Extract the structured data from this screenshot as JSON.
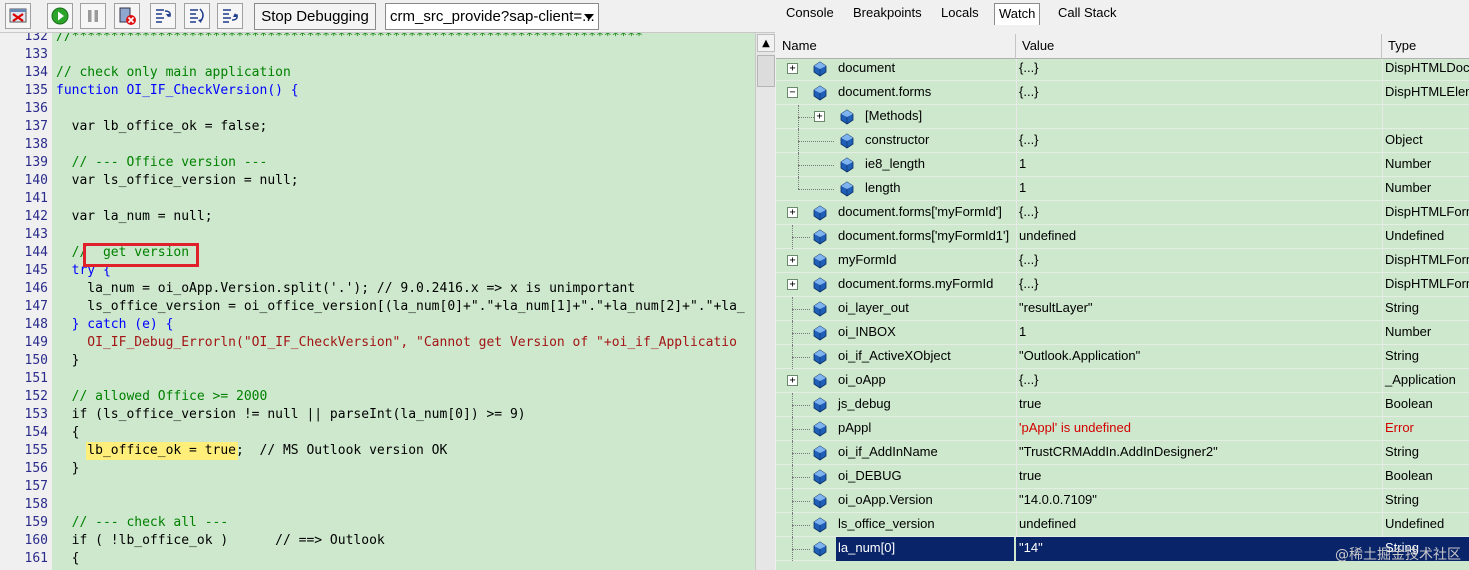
{
  "toolbar": {
    "stop_label": "Stop Debugging",
    "source_select": "crm_src_provide?sap-client=..."
  },
  "tabs": [
    "Console",
    "Breakpoints",
    "Locals",
    "Watch",
    "Call Stack"
  ],
  "active_tab": "Watch",
  "watch": {
    "columns": [
      "Name",
      "Value",
      "Type"
    ],
    "rows": [
      {
        "name": "document",
        "value": "{...}",
        "type": "DispHTMLDocu",
        "expander": "plus",
        "level": 0
      },
      {
        "name": "document.forms",
        "value": "{...}",
        "type": "DispHTMLElem",
        "expander": "minus",
        "level": 0
      },
      {
        "name": "[Methods]",
        "value": "",
        "type": "",
        "expander": "plus",
        "level": 1
      },
      {
        "name": "constructor",
        "value": "{...}",
        "type": "Object",
        "expander": "",
        "level": 1
      },
      {
        "name": "ie8_length",
        "value": "1",
        "type": "Number",
        "expander": "",
        "level": 1
      },
      {
        "name": "length",
        "value": "1",
        "type": "Number",
        "expander": "",
        "level": 1
      },
      {
        "name": "document.forms['myFormId']",
        "value": "{...}",
        "type": "DispHTMLForm",
        "expander": "plus",
        "level": 0
      },
      {
        "name": "document.forms['myFormId1']",
        "value": "undefined",
        "type": "Undefined",
        "expander": "",
        "level": 0
      },
      {
        "name": "myFormId",
        "value": "{...}",
        "type": "DispHTMLForm",
        "expander": "plus",
        "level": 0
      },
      {
        "name": "document.forms.myFormId",
        "value": "{...}",
        "type": "DispHTMLForm",
        "expander": "plus",
        "level": 0
      },
      {
        "name": "oi_layer_out",
        "value": "\"resultLayer\"",
        "type": "String",
        "expander": "",
        "level": 0
      },
      {
        "name": "oi_INBOX",
        "value": "1",
        "type": "Number",
        "expander": "",
        "level": 0
      },
      {
        "name": "oi_if_ActiveXObject",
        "value": "\"Outlook.Application\"",
        "type": "String",
        "expander": "",
        "level": 0
      },
      {
        "name": "oi_oApp",
        "value": "{...}",
        "type": "_Application",
        "expander": "plus",
        "level": 0
      },
      {
        "name": "js_debug",
        "value": "true",
        "type": "Boolean",
        "expander": "",
        "level": 0
      },
      {
        "name": "pAppl",
        "value": "'pAppl' is undefined",
        "type": "Error",
        "expander": "",
        "level": 0,
        "error": true
      },
      {
        "name": "oi_if_AddInName",
        "value": "\"TrustCRMAddIn.AddInDesigner2\"",
        "type": "String",
        "expander": "",
        "level": 0
      },
      {
        "name": "oi_DEBUG",
        "value": "true",
        "type": "Boolean",
        "expander": "",
        "level": 0
      },
      {
        "name": "oi_oApp.Version",
        "value": "\"14.0.0.7109\"",
        "type": "String",
        "expander": "",
        "level": 0
      },
      {
        "name": "ls_office_version",
        "value": "undefined",
        "type": "Undefined",
        "expander": "",
        "level": 0
      },
      {
        "name": "la_num[0]",
        "value": "\"14\"",
        "type": "String",
        "expander": "",
        "level": 0,
        "selected": true
      }
    ]
  },
  "editor": {
    "lines": [
      {
        "n": "132",
        "t": "//*************************************************************************"
      },
      {
        "n": "133",
        "t": ""
      },
      {
        "n": "134",
        "t": "// check only main application"
      },
      {
        "n": "135",
        "t": "function OI_IF_CheckVersion() {"
      },
      {
        "n": "136",
        "t": ""
      },
      {
        "n": "137",
        "t": "  var lb_office_ok = false;"
      },
      {
        "n": "138",
        "t": ""
      },
      {
        "n": "139",
        "t": "  // --- Office version ---"
      },
      {
        "n": "140",
        "t": "  var ls_office_version = null;"
      },
      {
        "n": "141",
        "t": ""
      },
      {
        "n": "142",
        "t": "  var la_num = null;"
      },
      {
        "n": "143",
        "t": ""
      },
      {
        "n": "144",
        "t": "  //  get version"
      },
      {
        "n": "145",
        "t": "  try {"
      },
      {
        "n": "146",
        "t": "    la_num = oi_oApp.Version.split('.'); // 9.0.2416.x => x is unimportant"
      },
      {
        "n": "147",
        "t": "    ls_office_version = oi_office_version[(la_num[0]+\".\"+la_num[1]+\".\"+la_num[2]+\".\"+la_"
      },
      {
        "n": "148",
        "t": "  } catch (e) {"
      },
      {
        "n": "149",
        "t": "    OI_IF_Debug_Errorln(\"OI_IF_CheckVersion\", \"Cannot get Version of \"+oi_if_Applicatio"
      },
      {
        "n": "150",
        "t": "  }"
      },
      {
        "n": "151",
        "t": ""
      },
      {
        "n": "152",
        "t": "  // allowed Office >= 2000"
      },
      {
        "n": "153",
        "t": "  if (ls_office_version != null || parseInt(la_num[0]) >= 9)"
      },
      {
        "n": "154",
        "t": "  {"
      },
      {
        "n": "155",
        "t": "    lb_office_ok = true;  // MS Outlook version OK"
      },
      {
        "n": "156",
        "t": "  }"
      },
      {
        "n": "157",
        "t": ""
      },
      {
        "n": "158",
        "t": ""
      },
      {
        "n": "159",
        "t": "  // --- check all ---"
      },
      {
        "n": "160",
        "t": "  if ( !lb_office_ok )      // ==> Outlook"
      },
      {
        "n": "161",
        "t": "  {"
      }
    ]
  },
  "watermark": "@稀土掘金技术社区",
  "colors": {
    "editor_bg": "#cde8cd",
    "selected_row": "#0a246a",
    "error": "#d40000",
    "highlight": "#ffee7a",
    "red_box": "#e0202a"
  }
}
